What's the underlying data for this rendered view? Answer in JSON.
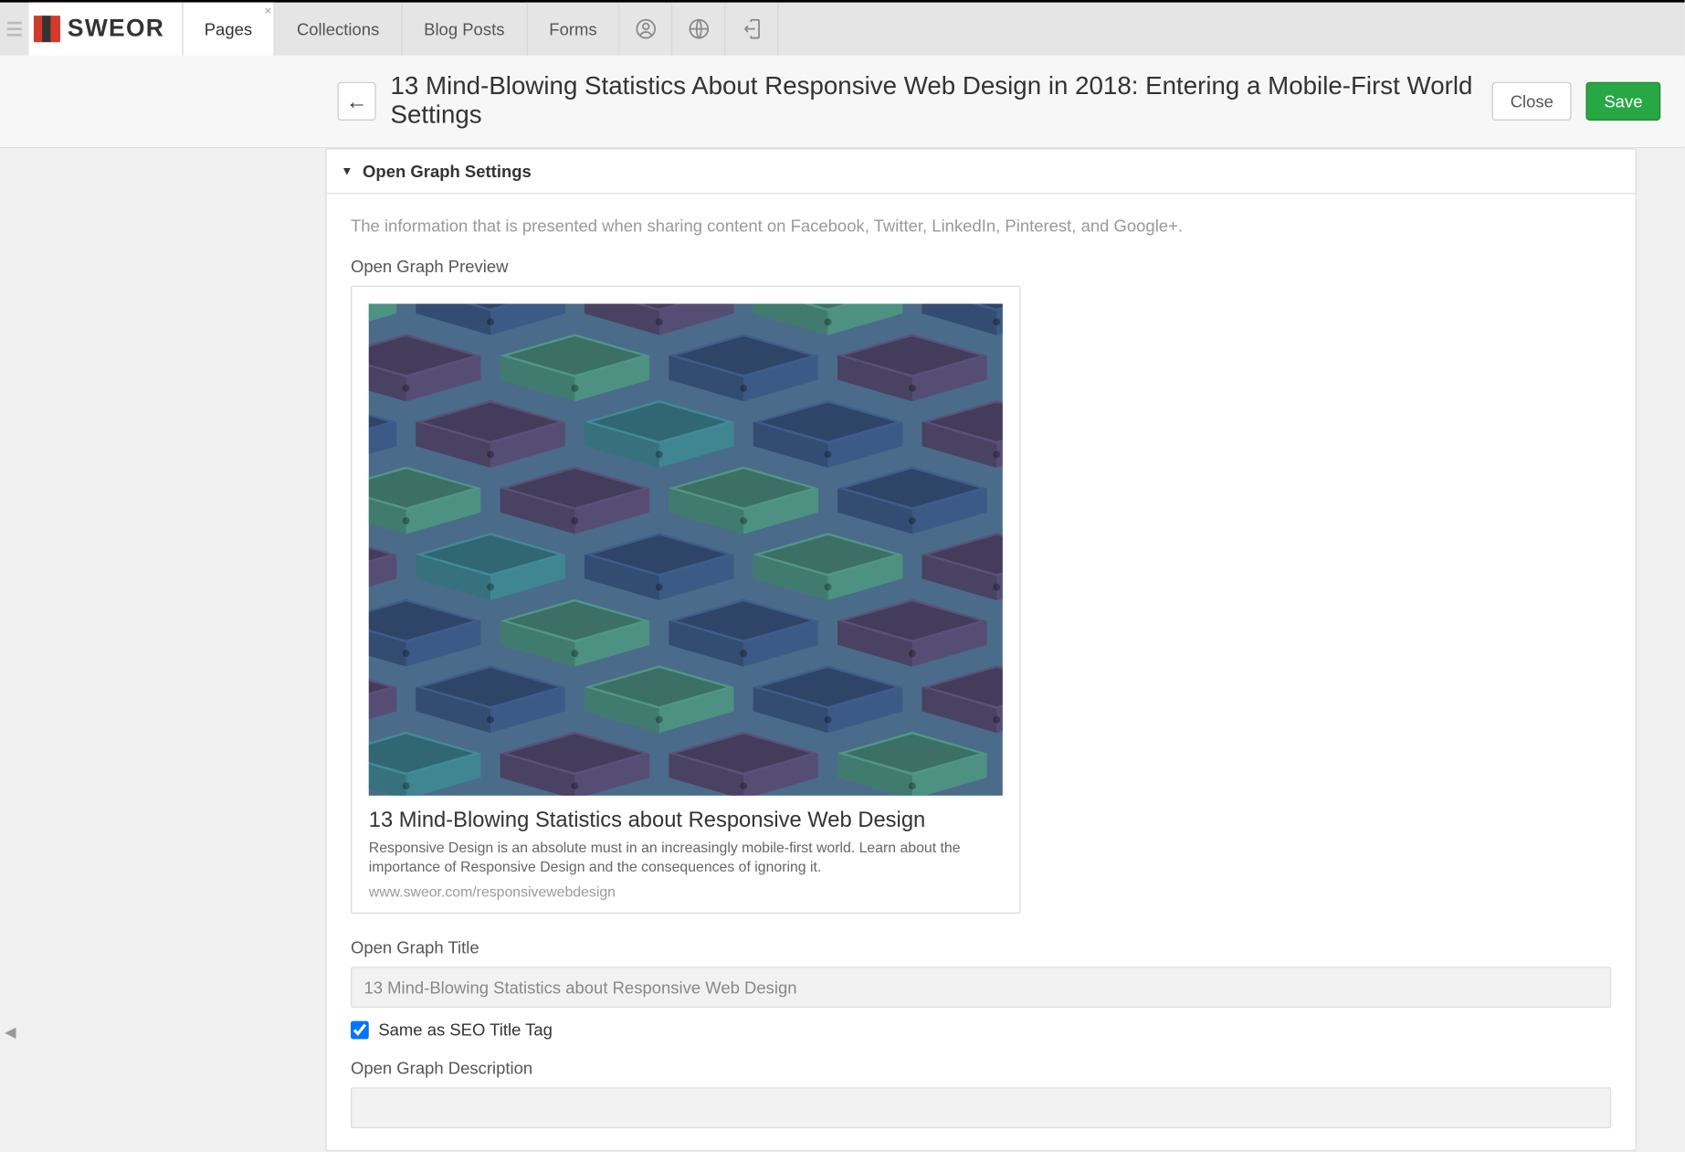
{
  "app": {
    "logo_text": "SWEOR",
    "nav": [
      {
        "label": "Pages",
        "active": true,
        "closable": true
      },
      {
        "label": "Collections"
      },
      {
        "label": "Blog Posts"
      },
      {
        "label": "Forms"
      }
    ]
  },
  "header": {
    "title": "13 Mind-Blowing Statistics About Responsive Web Design in 2018: Entering a Mobile-First World Settings",
    "close_label": "Close",
    "save_label": "Save"
  },
  "panel": {
    "title": "Open Graph Settings",
    "help": "The information that is presented when sharing content on Facebook, Twitter, LinkedIn, Pinterest, and Google+.",
    "preview_label": "Open Graph Preview",
    "preview": {
      "title": "13 Mind-Blowing Statistics about Responsive Web Design",
      "description": "Responsive Design is an absolute must in an increasingly mobile-first world. Learn about the importance of Responsive Design and the consequences of ignoring it.",
      "url": "www.sweor.com/responsivewebdesign"
    },
    "og_title_label": "Open Graph Title",
    "og_title_value": "13 Mind-Blowing Statistics about Responsive Web Design",
    "same_as_seo_label": "Same as SEO Title Tag",
    "same_as_seo_checked": true,
    "og_desc_label": "Open Graph Description"
  }
}
